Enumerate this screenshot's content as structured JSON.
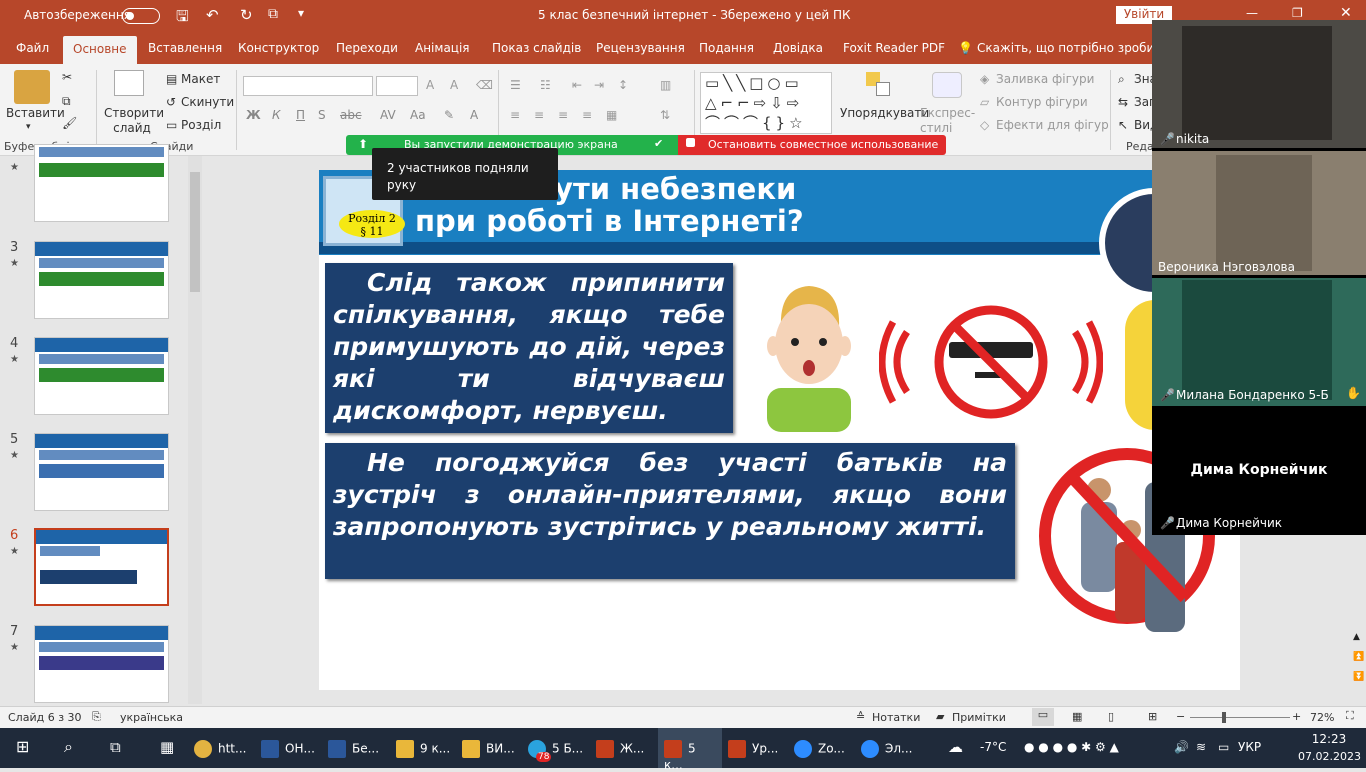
{
  "titlebar": {
    "autosave": "Автозбереження",
    "doc_title": "5 клас безпечний інтернет  -  Збережено у цей ПК",
    "signin": "Увійти"
  },
  "tabs": [
    "Файл",
    "Основне",
    "Вставлення",
    "Конструктор",
    "Переходи",
    "Анімація",
    "Показ слайдів",
    "Рецензування",
    "Подання",
    "Довідка",
    "Foxit Reader PDF"
  ],
  "tell_me": "Скажіть, що потрібно зробити",
  "ribbon": {
    "paste": "Вставити",
    "clipboard_group": "Буфер обміну",
    "new_slide": "Створити слайд",
    "layout": "Макет",
    "reset": "Скинути",
    "section": "Розділ",
    "slides_group": "Слайди",
    "arrange": "Упорядкувати",
    "quick_styles": "Експрес-стилі",
    "shape_fill": "Заливка фігури",
    "shape_outline": "Контур фігури",
    "shape_effects": "Ефекти для фігур",
    "find": "Зна",
    "replace": "Зап",
    "select": "Вид",
    "editing_group": "Реда"
  },
  "share_bar": {
    "started": "Вы запустили демонстрацию экрана",
    "stop": "Остановить совместное использование",
    "tooltip": "2 участников подняли руку"
  },
  "slide": {
    "title_line1": "нути небезпеки",
    "title_line2": "при роботі в Інтернеті?",
    "badge_line1": "Розділ 2",
    "badge_line2": "§ 11",
    "box1": "Слід також припинити спілкування, якщо тебе примушують до дій, через які ти відчуваєш дискомфорт, нервуєш.",
    "box2": "Не погоджуйся без участі батьків на зустріч з онлайн-приятелями, якщо вони запропонують зустрітись у реальному житті."
  },
  "thumbnails": [
    {
      "num": "",
      "star": "★"
    },
    {
      "num": "3",
      "star": "★"
    },
    {
      "num": "4",
      "star": "★"
    },
    {
      "num": "5",
      "star": "★"
    },
    {
      "num": "6",
      "star": "★"
    },
    {
      "num": "7",
      "star": "★"
    }
  ],
  "status": {
    "slide": "Слайд 6 з 30",
    "language": "українська",
    "notes": "Нотатки",
    "comments": "Примітки",
    "zoom": "72%"
  },
  "zoom_panel": {
    "participants": [
      {
        "name": "nikita"
      },
      {
        "name": "Вероника Нэговэлова"
      },
      {
        "name": "Милана Бондаренко 5-Б"
      },
      {
        "name": "Дима Корнейчик",
        "center_label": "Дима Корнейчик"
      }
    ]
  },
  "taskbar": {
    "items": [
      "htt...",
      "ОН...",
      "Бе...",
      "9 к...",
      "ВИ...",
      "5 Б...",
      "Ж...",
      "5 к...",
      "Ур...",
      "Zo...",
      "Эл..."
    ],
    "badge": "78",
    "weather": "-7°C",
    "lang": "УКР",
    "time": "12:23",
    "date": "07.02.2023"
  }
}
